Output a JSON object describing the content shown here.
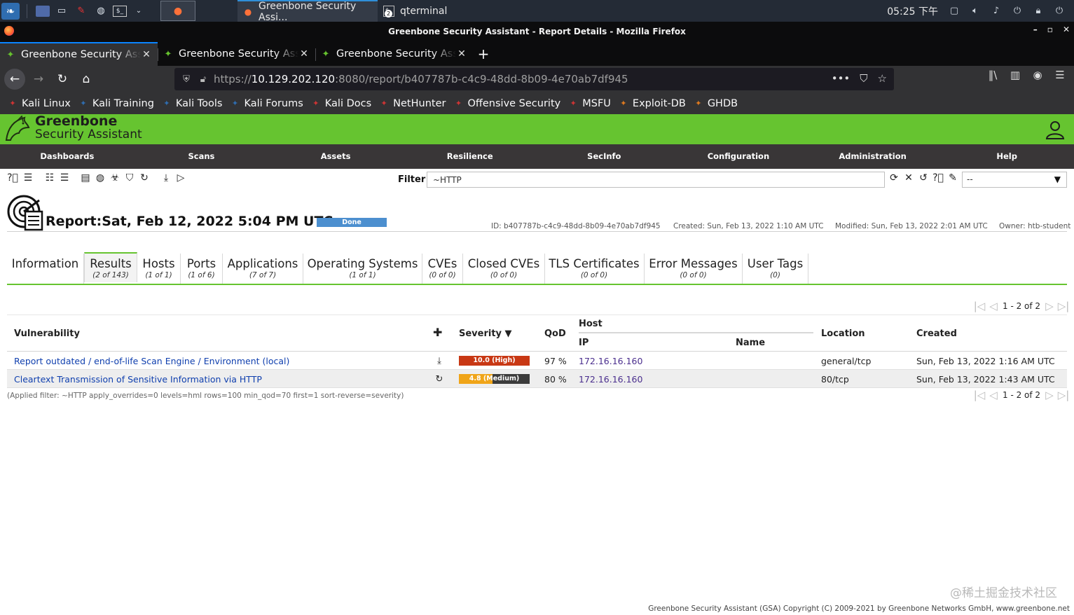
{
  "os": {
    "taskbar_tasks": [
      {
        "label": "Greenbone Security Assi..."
      },
      {
        "label": "qterminal"
      }
    ],
    "clock": "05:25 下午",
    "terminal_badge": "2"
  },
  "browser": {
    "window_title": "Greenbone Security Assistant - Report Details - Mozilla Firefox",
    "tabs": [
      {
        "title": "Greenbone Security Assistant"
      },
      {
        "title": "Greenbone Security Assistant"
      },
      {
        "title": "Greenbone Security Assistant"
      }
    ],
    "url_prefix": "https://",
    "url_host": "10.129.202.120",
    "url_rest": ":8080/report/b407787b-c4c9-48dd-8b09-4e70ab7df945",
    "bookmarks": [
      {
        "label": "Kali Linux",
        "color": "#cf3434"
      },
      {
        "label": "Kali Training",
        "color": "#2f6db0"
      },
      {
        "label": "Kali Tools",
        "color": "#2f6db0"
      },
      {
        "label": "Kali Forums",
        "color": "#2f6db0"
      },
      {
        "label": "Kali Docs",
        "color": "#cf3434"
      },
      {
        "label": "NetHunter",
        "color": "#cf3434"
      },
      {
        "label": "Offensive Security",
        "color": "#cf3434"
      },
      {
        "label": "MSFU",
        "color": "#cf3434"
      },
      {
        "label": "Exploit-DB",
        "color": "#e07a1f"
      },
      {
        "label": "GHDB",
        "color": "#e07a1f"
      }
    ]
  },
  "gsa": {
    "brand_line1": "Greenbone",
    "brand_line2": "Security Assistant",
    "menu": [
      "Dashboards",
      "Scans",
      "Assets",
      "Resilience",
      "SecInfo",
      "Configuration",
      "Administration",
      "Help"
    ],
    "filter_label": "Filter",
    "filter_value": "~HTTP",
    "filter_select": "--",
    "report": {
      "title": "Report:Sat, Feb 12, 2022 5:04 PM UTC",
      "status": "Done",
      "id": "ID: b407787b-c4c9-48dd-8b09-4e70ab7df945",
      "created": "Created: Sun, Feb 13, 2022 1:10 AM UTC",
      "modified": "Modified: Sun, Feb 13, 2022 2:01 AM UTC",
      "owner": "Owner: htb-student"
    },
    "tabs": [
      {
        "label": "Information",
        "count": ""
      },
      {
        "label": "Results",
        "count": "(2 of 143)"
      },
      {
        "label": "Hosts",
        "count": "(1 of 1)"
      },
      {
        "label": "Ports",
        "count": "(1 of 6)"
      },
      {
        "label": "Applications",
        "count": "(7 of 7)"
      },
      {
        "label": "Operating Systems",
        "count": "(1 of 1)"
      },
      {
        "label": "CVEs",
        "count": "(0 of 0)"
      },
      {
        "label": "Closed CVEs",
        "count": "(0 of 0)"
      },
      {
        "label": "TLS Certificates",
        "count": "(0 of 0)"
      },
      {
        "label": "Error Messages",
        "count": "(0 of 0)"
      },
      {
        "label": "User Tags",
        "count": "(0)"
      }
    ],
    "pager_text": "1 - 2 of 2",
    "columns": {
      "vulnerability": "Vulnerability",
      "severity": "Severity ▼",
      "qod": "QoD",
      "host": "Host",
      "ip": "IP",
      "name": "Name",
      "location": "Location",
      "created": "Created"
    },
    "results": [
      {
        "vulnerability": "Report outdated / end-of-life Scan Engine / Environment (local)",
        "solution_icon": "vendorfix-icon",
        "severity_value": 10.0,
        "severity_label": "10.0 (High)",
        "severity_color": "#c83814",
        "qod": "97 %",
        "ip": "172.16.16.160",
        "name": "",
        "location": "general/tcp",
        "created": "Sun, Feb 13, 2022 1:16 AM UTC"
      },
      {
        "vulnerability": "Cleartext Transmission of Sensitive Information via HTTP",
        "solution_icon": "workaround-icon",
        "severity_value": 4.8,
        "severity_label": "4.8 (Medium)",
        "severity_color": "#f0a519",
        "qod": "80 %",
        "ip": "172.16.16.160",
        "name": "",
        "location": "80/tcp",
        "created": "Sun, Feb 13, 2022 1:43 AM UTC"
      }
    ],
    "applied_filter": "(Applied filter: ~HTTP apply_overrides=0 levels=hml rows=100 min_qod=70 first=1 sort-reverse=severity)",
    "watermark": "@稀土掘金技术社区",
    "footer": "Greenbone Security Assistant (GSA) Copyright (C) 2009-2021 by Greenbone Networks GmbH, www.greenbone.net"
  }
}
